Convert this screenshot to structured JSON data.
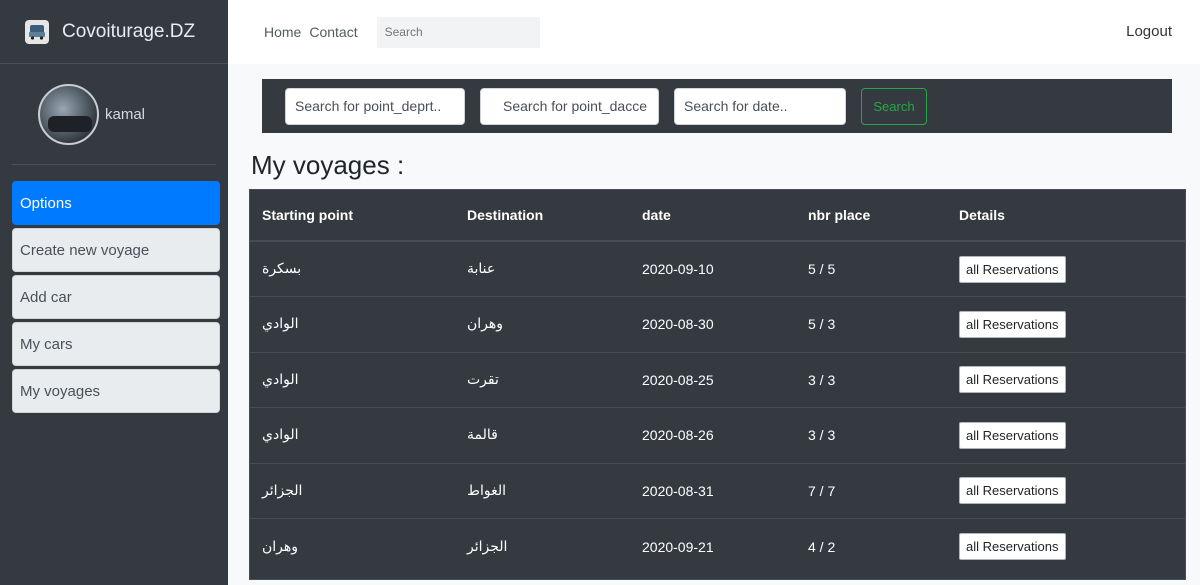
{
  "brand": {
    "name": "Covoiturage.DZ"
  },
  "user": {
    "name": "kamal"
  },
  "menu": [
    {
      "label": "Options",
      "active": true
    },
    {
      "label": "Create new voyage"
    },
    {
      "label": "Add car"
    },
    {
      "label": "My cars"
    },
    {
      "label": "My voyages"
    }
  ],
  "nav": {
    "home": "Home",
    "contact": "Contact",
    "search_placeholder": "Search",
    "logout": "Logout"
  },
  "search": {
    "depart_placeholder": "Search for point_deprt..",
    "dest_placeholder": "Search for point_dacce",
    "date_placeholder": "Search for date..",
    "button": "Search"
  },
  "page": {
    "title": "My voyages :"
  },
  "table": {
    "headers": [
      "Starting point",
      "Destination",
      "date",
      "nbr place",
      "Details"
    ],
    "button_label": "all Reservations",
    "rows": [
      [
        "بسكرة",
        "عنابة",
        "2020-09-10",
        "5 / 5"
      ],
      [
        "الوادي",
        "وهران",
        "2020-08-30",
        "5 / 3"
      ],
      [
        "الوادي",
        "تقرت",
        "2020-08-25",
        "3 / 3"
      ],
      [
        "الوادي",
        "قالمة",
        "2020-08-26",
        "3 / 3"
      ],
      [
        "الجزائر",
        "الغواط",
        "2020-08-31",
        "7 / 7"
      ],
      [
        "وهران",
        "الجزائر",
        "2020-09-21",
        "4 / 2"
      ]
    ]
  },
  "colors": {
    "sidebar": "#343a40",
    "active": "#007bff",
    "success": "#28a745"
  }
}
